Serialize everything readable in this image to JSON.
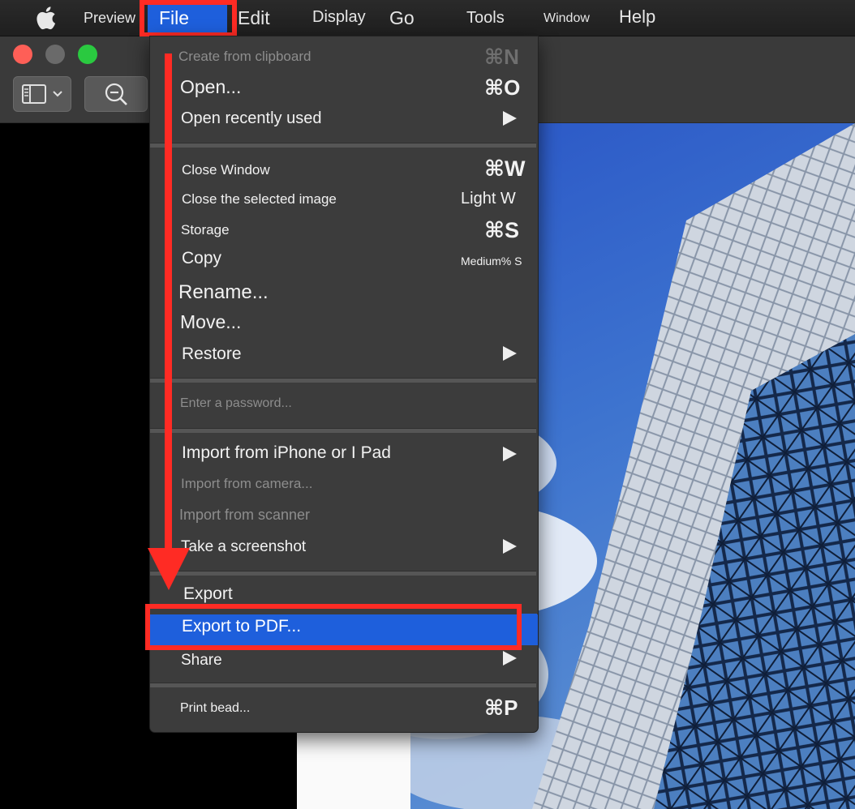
{
  "menubar": {
    "items": [
      "Preview",
      "File",
      "Edit",
      "Display",
      "Go",
      "Tools",
      "Window",
      "Help"
    ]
  },
  "toolbar": {
    "sidebar_icon": "sidebar-icon",
    "zoom_icon": "zoom-out-icon"
  },
  "file_menu": {
    "items": [
      {
        "label": "Create from clipboard",
        "shortcut": "⌘N",
        "enabled": false
      },
      {
        "label": "Open...",
        "shortcut": "⌘O"
      },
      {
        "label": "Open recently used",
        "submenu": true
      },
      {
        "label": "Close Window",
        "shortcut": "⌘W"
      },
      {
        "label": "Close the selected image",
        "shortcut": "Light W"
      },
      {
        "label": "Storage",
        "shortcut": "⌘S"
      },
      {
        "label": "Copy",
        "shortcut": "Medium% S"
      },
      {
        "label": "Rename..."
      },
      {
        "label": "Move..."
      },
      {
        "label": "Restore",
        "submenu": true
      },
      {
        "label": "Enter a password...",
        "enabled": false
      },
      {
        "label": "Import from iPhone or I Pad",
        "submenu": true
      },
      {
        "label": "Import from camera...",
        "enabled": false
      },
      {
        "label": "Import from scanner",
        "enabled": false
      },
      {
        "label": "Take a screenshot",
        "submenu": true
      },
      {
        "label": "Export"
      },
      {
        "label": "Export to PDF...",
        "highlighted": true
      },
      {
        "label": "Share",
        "submenu": true
      },
      {
        "label": "Print bead...",
        "shortcut": "⌘P"
      }
    ]
  },
  "colors": {
    "highlight": "#1e5fdc",
    "annotation": "#ff2b24",
    "menu_bg": "#3c3c3c"
  }
}
